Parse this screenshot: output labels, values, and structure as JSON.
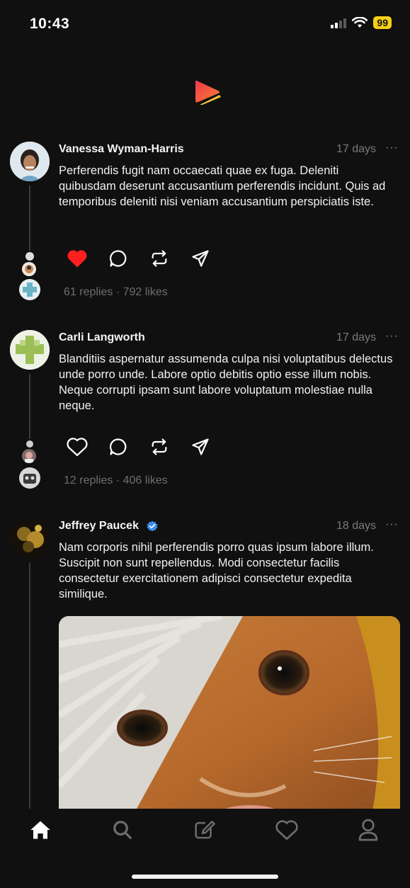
{
  "status_bar": {
    "time": "10:43",
    "battery": "99"
  },
  "app": {
    "brand_color": "#f0473a"
  },
  "posts": [
    {
      "author": "Vanessa Wyman-Harris",
      "verified": false,
      "time": "17 days",
      "more": "···",
      "text": "Perferendis fugit nam occaecati quae ex fuga. Deleniti quibusdam deserunt accusantium perferendis incidunt. Quis ad temporibus deleniti nisi veniam accusantium perspiciatis iste.",
      "liked": true,
      "stats": "61 replies · 792 likes"
    },
    {
      "author": "Carli Langworth",
      "verified": false,
      "time": "17 days",
      "more": "···",
      "text": "Blanditiis aspernatur assumenda culpa nisi voluptatibus delectus unde porro unde. Labore optio debitis optio esse illum nobis. Neque corrupti ipsam sunt labore voluptatum molestiae nulla neque.",
      "liked": false,
      "stats": "12 replies · 406 likes"
    },
    {
      "author": "Jeffrey Paucek",
      "verified": true,
      "time": "18 days",
      "more": "···",
      "text": "Nam corporis nihil perferendis porro quas ipsum labore illum. Suscipit non sunt repellendus. Modi consectetur facilis consectetur exercitationem adipisci consectetur expedita similique.",
      "has_image": true
    }
  ],
  "tab_bar": {
    "items": [
      "home-icon",
      "search-icon",
      "compose-icon",
      "activity-heart-icon",
      "profile-icon"
    ],
    "active": "home-icon"
  }
}
